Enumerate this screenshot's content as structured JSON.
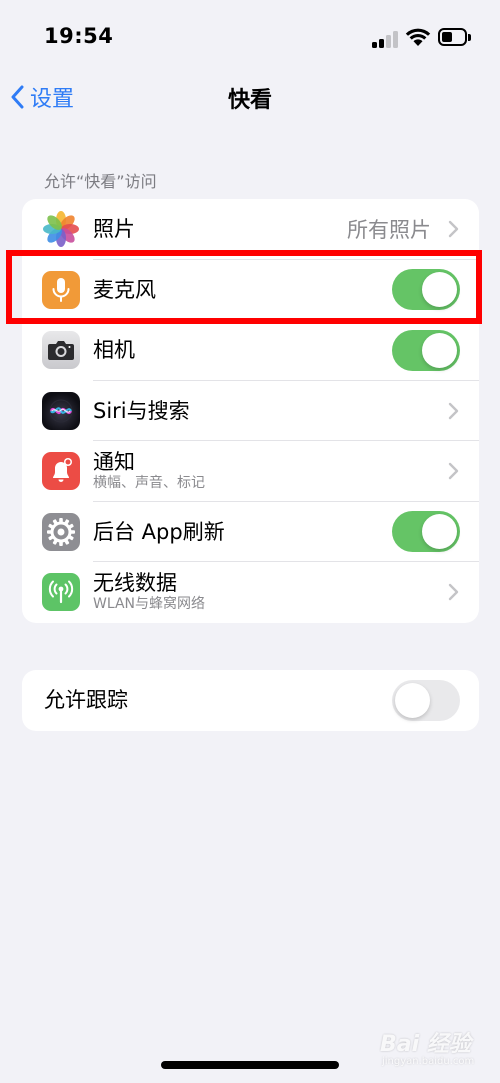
{
  "status_bar": {
    "time": "19:54"
  },
  "nav": {
    "back_label": "设置",
    "title": "快看"
  },
  "section_header": "允许“快看”访问",
  "access_items": [
    {
      "label": "照片",
      "value": "所有照片",
      "icon": "photos-icon",
      "accessory": "chevron"
    },
    {
      "label": "麦克风",
      "icon": "microphone-icon",
      "accessory": "toggle",
      "on": true
    },
    {
      "label": "相机",
      "icon": "camera-icon",
      "accessory": "toggle",
      "on": true
    },
    {
      "label": "Siri与搜索",
      "icon": "siri-icon",
      "accessory": "chevron"
    },
    {
      "label": "通知",
      "sublabel": "横幅、声音、标记",
      "icon": "notification-bell-icon",
      "accessory": "chevron"
    },
    {
      "label": "后台 App刷新",
      "icon": "gear-icon",
      "accessory": "toggle",
      "on": true
    },
    {
      "label": "无线数据",
      "sublabel": "WLAN与蜂窝网络",
      "icon": "antenna-icon",
      "accessory": "chevron"
    }
  ],
  "tracking": {
    "label": "允许跟踪",
    "on": false
  },
  "watermark": {
    "brand": "Bai 经验",
    "domain": "jingyan.baidu.com"
  },
  "colors": {
    "accent": "#2f7cf6",
    "toggle_on": "#65c466",
    "toggle_off": "#e9e9eb",
    "highlight": "#ff0000",
    "background": "#f2f2f7"
  }
}
